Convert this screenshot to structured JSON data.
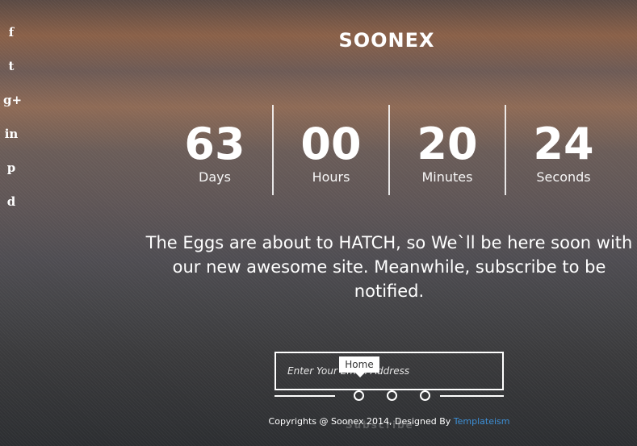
{
  "social": {
    "facebook": "f",
    "twitter": "t",
    "google_plus": "g+",
    "linkedin": "in",
    "pinterest": "p",
    "dribbble": "d"
  },
  "logo": "SOONEX",
  "countdown": [
    {
      "value": "63",
      "label": "Days"
    },
    {
      "value": "00",
      "label": "Hours"
    },
    {
      "value": "20",
      "label": "Minutes"
    },
    {
      "value": "24",
      "label": "Seconds"
    }
  ],
  "message": "The Eggs are about to HATCH, so We`ll be here soon with our new awesome site. Meanwhile, subscribe to be notified.",
  "subscribe": {
    "placeholder": "Enter Your Email Address",
    "button_label": "Subscribe",
    "tooltip": "Home"
  },
  "footer": {
    "text": "Copyrights @ Soonex 2014, Designed By ",
    "link": "Templateism"
  },
  "colors": {
    "link": "#3d8fd6"
  }
}
